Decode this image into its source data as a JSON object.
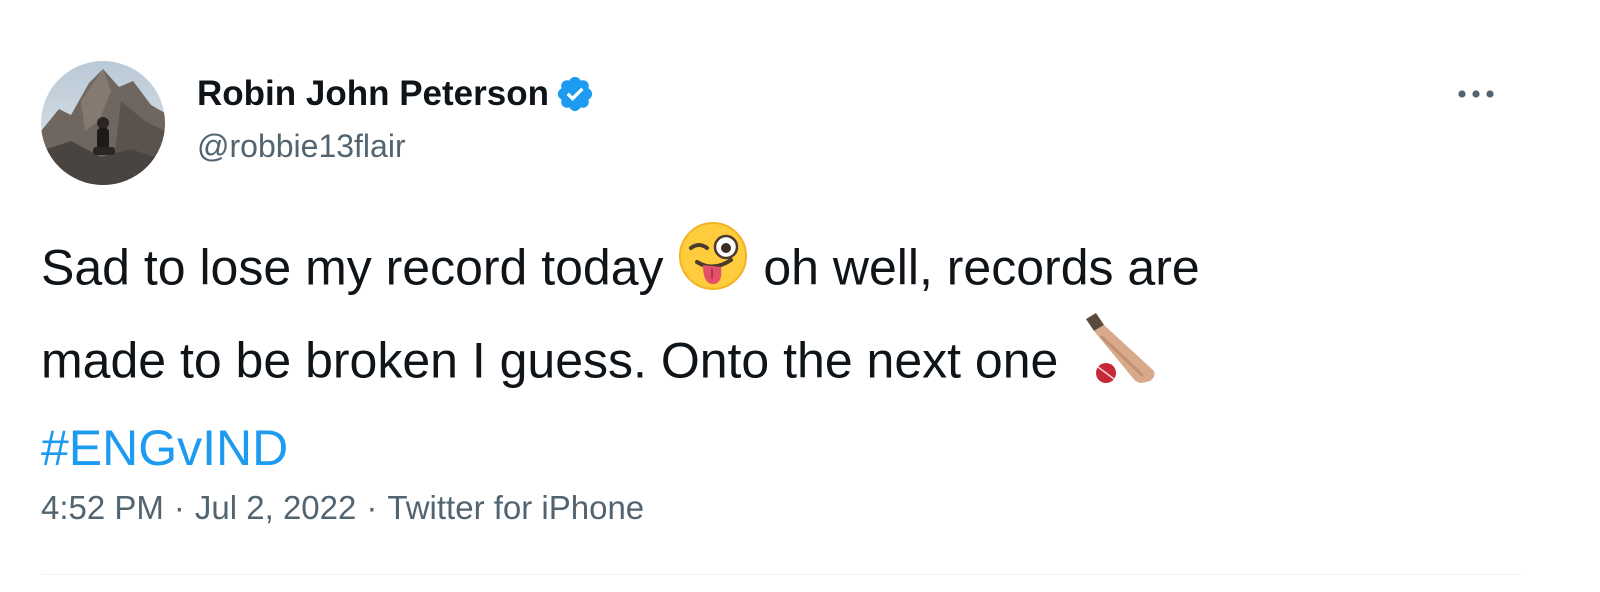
{
  "author": {
    "display_name": "Robin John Peterson",
    "handle": "@robbie13flair",
    "verified": true,
    "verified_color": "#1d9bf0"
  },
  "tweet": {
    "line1_a": "Sad to lose my record today",
    "emoji1": "winking-face-with-tongue",
    "line1_b": "oh well, records are",
    "line2": "made to be broken I guess. Onto the next one",
    "emoji2": "cricket-bat-and-ball",
    "hashtag": "#ENGvIND",
    "hashtag_color": "#1d9bf0"
  },
  "meta": {
    "time": "4:52 PM",
    "separator": "·",
    "date": "Jul 2, 2022",
    "source": "Twitter for iPhone"
  },
  "icons": {
    "more": "more-horizontal-icon"
  },
  "colors": {
    "text": "#0f1419",
    "secondary": "#536471",
    "link": "#1d9bf0"
  }
}
